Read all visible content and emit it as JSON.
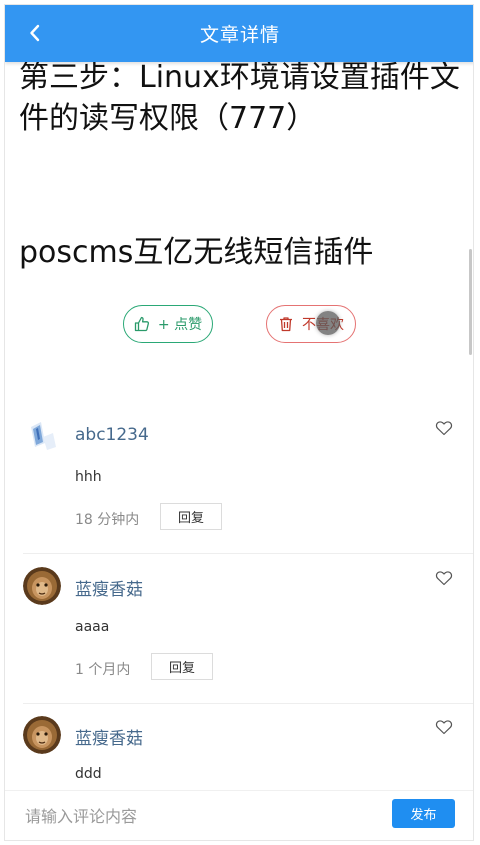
{
  "header": {
    "title": "文章详情",
    "back_icon": "chevron-left-icon",
    "bg_color": "#3396f2"
  },
  "article": {
    "heading": "第三步：Linux环境请设置插件文件的读写权限（777）",
    "subheading": "poscms互亿无线短信插件"
  },
  "votes": {
    "like_label": "+ 点赞",
    "like_icon": "thumbs-up-icon",
    "dislike_label": "不喜欢",
    "dislike_icon": "trash-icon"
  },
  "comments": [
    {
      "user": "abc1234",
      "text": "hhh",
      "time": "18 分钟内",
      "reply_label": "回复",
      "avatar": "placeholder-avatar"
    },
    {
      "user": "蓝瘦香菇",
      "text": "aaaa",
      "time": "1 个月内",
      "reply_label": "回复",
      "avatar": "lion-avatar"
    },
    {
      "user": "蓝瘦香菇",
      "text": "ddd",
      "avatar": "lion-avatar"
    }
  ],
  "footer": {
    "placeholder": "请输入评论内容",
    "publish_label": "发布"
  }
}
